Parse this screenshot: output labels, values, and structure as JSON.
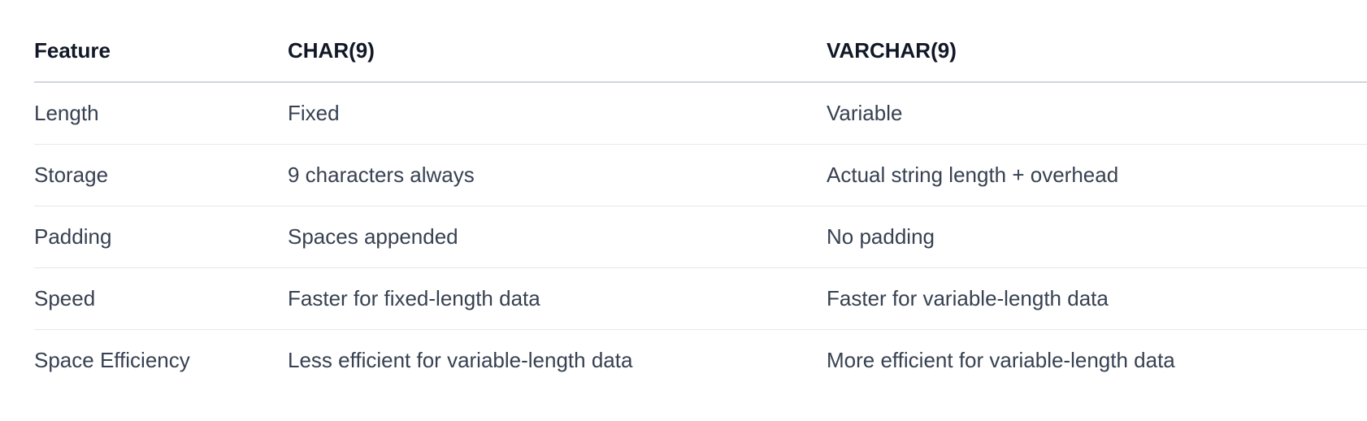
{
  "table": {
    "headers": [
      "Feature",
      "CHAR(9)",
      "VARCHAR(9)"
    ],
    "rows": [
      [
        "Length",
        "Fixed",
        "Variable"
      ],
      [
        "Storage",
        "9 characters always",
        "Actual string length + overhead"
      ],
      [
        "Padding",
        "Spaces appended",
        "No padding"
      ],
      [
        "Speed",
        "Faster for fixed-length data",
        "Faster for variable-length data"
      ],
      [
        "Space Efficiency",
        "Less efficient for variable-length data",
        "More efficient for variable-length data"
      ]
    ]
  }
}
